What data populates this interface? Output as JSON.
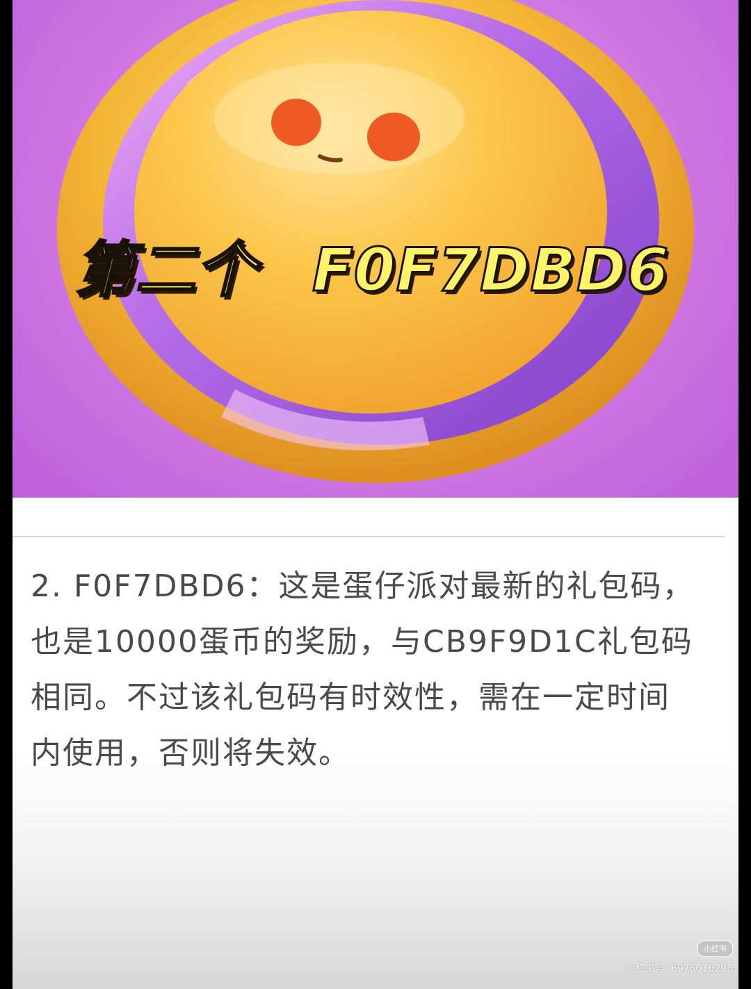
{
  "hero": {
    "overlay_prefix": "第二个",
    "overlay_code": "F0F7DBD6"
  },
  "article": {
    "paragraph": "2. F0F7DBD6：这是蛋仔派对最新的礼包码，也是10000蛋币的奖励，与CB9F9D1C礼包码相同。不过该礼包码有时效性，需在一定时间内使用，否则将失效。"
  },
  "watermark": {
    "logo": "小红书",
    "id_text": "小红书号: 6975016298"
  },
  "colors": {
    "hero_purple": "#cf78e4",
    "coin_gold": "#f4b73a",
    "overlay_yellow": "#fff36a",
    "divider": "#bfe2dd",
    "text_gray": "#4a4a4a"
  }
}
